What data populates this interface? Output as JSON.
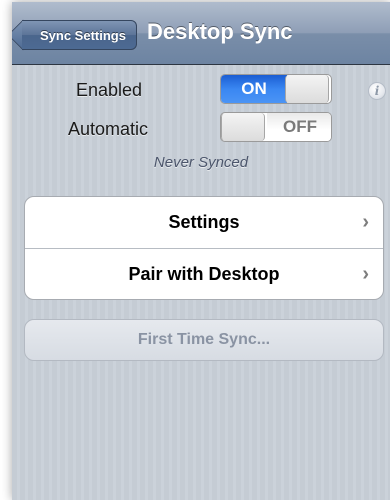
{
  "navbar": {
    "back_label": "Sync Settings",
    "title": "Desktop Sync"
  },
  "settings": {
    "enabled_label": "Enabled",
    "enabled_state": "ON",
    "automatic_label": "Automatic",
    "automatic_state": "OFF",
    "status": "Never Synced"
  },
  "list": {
    "items": [
      {
        "label": "Settings",
        "accessory": "›"
      },
      {
        "label": "Pair with Desktop",
        "accessory": "›"
      }
    ]
  },
  "actions": {
    "first_time_sync_label": "First Time Sync..."
  },
  "icons": {
    "info": "info-icon",
    "chevron": "chevron-right-icon"
  },
  "colors": {
    "switch_on": "#3a87f2",
    "navbar": "#8e9eb6",
    "background": "#c5ccd4"
  }
}
